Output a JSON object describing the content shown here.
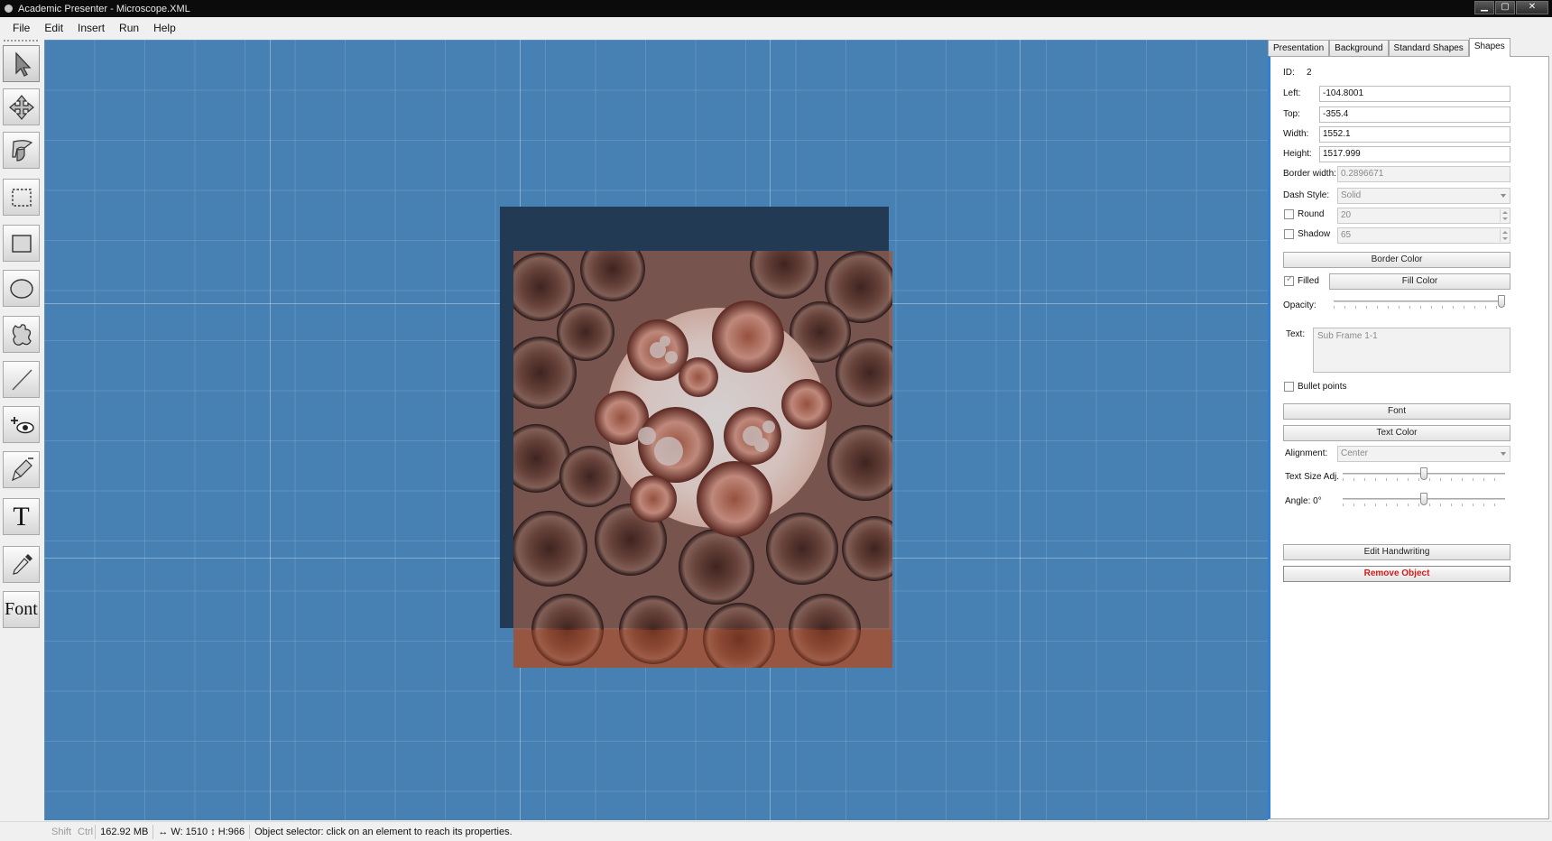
{
  "window": {
    "title": "Academic Presenter - Microscope.XML",
    "buttons": {
      "minimize": "▁",
      "maximize": "▢",
      "close": "✕"
    }
  },
  "menu": [
    "File",
    "Edit",
    "Insert",
    "Run",
    "Help"
  ],
  "toolbar": {
    "tools": [
      {
        "name": "pointer-tool-icon",
        "active": true
      },
      {
        "name": "move-tool-icon",
        "active": false
      },
      {
        "name": "pan-hand-tool-icon",
        "active": false
      },
      {
        "name": "marquee-select-tool-icon",
        "active": false
      },
      {
        "name": "rectangle-tool-icon",
        "active": false
      },
      {
        "name": "ellipse-tool-icon",
        "active": false
      },
      {
        "name": "freeform-shape-tool-icon",
        "active": false
      },
      {
        "name": "line-tool-icon",
        "active": false
      },
      {
        "name": "add-view-tool-icon",
        "active": false
      },
      {
        "name": "pen-tool-icon",
        "active": false
      },
      {
        "name": "text-tool-icon",
        "active": false
      },
      {
        "name": "eyedropper-tool-icon",
        "active": false
      },
      {
        "name": "font-tool-icon",
        "active": false
      }
    ],
    "text_tool_label": "T",
    "font_tool_label": "Font"
  },
  "tabs": [
    {
      "label": "Presentation",
      "active": false
    },
    {
      "label": "Background",
      "active": false
    },
    {
      "label": "Standard Shapes",
      "active": false
    },
    {
      "label": "Shapes",
      "active": true
    }
  ],
  "shape_props": {
    "id_label": "ID:",
    "id_value": "2",
    "left_label": "Left:",
    "left_value": "-104.8001",
    "top_label": "Top:",
    "top_value": "-355.4",
    "width_label": "Width:",
    "width_value": "1552.1",
    "height_label": "Height:",
    "height_value": "1517.999",
    "border_width_label": "Border width:",
    "border_width_value": "0.2896671",
    "dash_style_label": "Dash Style:",
    "dash_style_value": "Solid",
    "round_label": "Round",
    "round_checked": false,
    "round_value": "20",
    "shadow_label": "Shadow",
    "shadow_checked": false,
    "shadow_value": "65",
    "border_color_button": "Border Color",
    "filled_label": "Filled",
    "filled_checked": true,
    "fill_color_button": "Fill Color",
    "opacity_label": "Opacity:",
    "opacity_value": 1.0,
    "text_label": "Text:",
    "text_value": "Sub Frame 1-1",
    "bullet_points_label": "Bullet points",
    "bullet_points_checked": false,
    "font_button": "Font",
    "text_color_button": "Text Color",
    "alignment_label": "Alignment:",
    "alignment_value": "Center",
    "text_size_adj_label": "Text Size Adj.",
    "text_size_adj_value": 0.5,
    "angle_label": "Angle: 0°",
    "angle_value": 0.5,
    "edit_handwriting_button": "Edit Handwriting",
    "remove_object_button": "Remove Object"
  },
  "status": {
    "shift": "Shift",
    "ctrl": "Ctrl",
    "memory": "162.92 MB",
    "dimensions": "↔ W: 1510 ↕ H:966",
    "message": "Object selector: click on an element to reach its properties."
  },
  "colors": {
    "canvas": "#4781b4",
    "frame": "#233a55",
    "accent": "#2f7fd8",
    "remove": "#d11a1a"
  }
}
